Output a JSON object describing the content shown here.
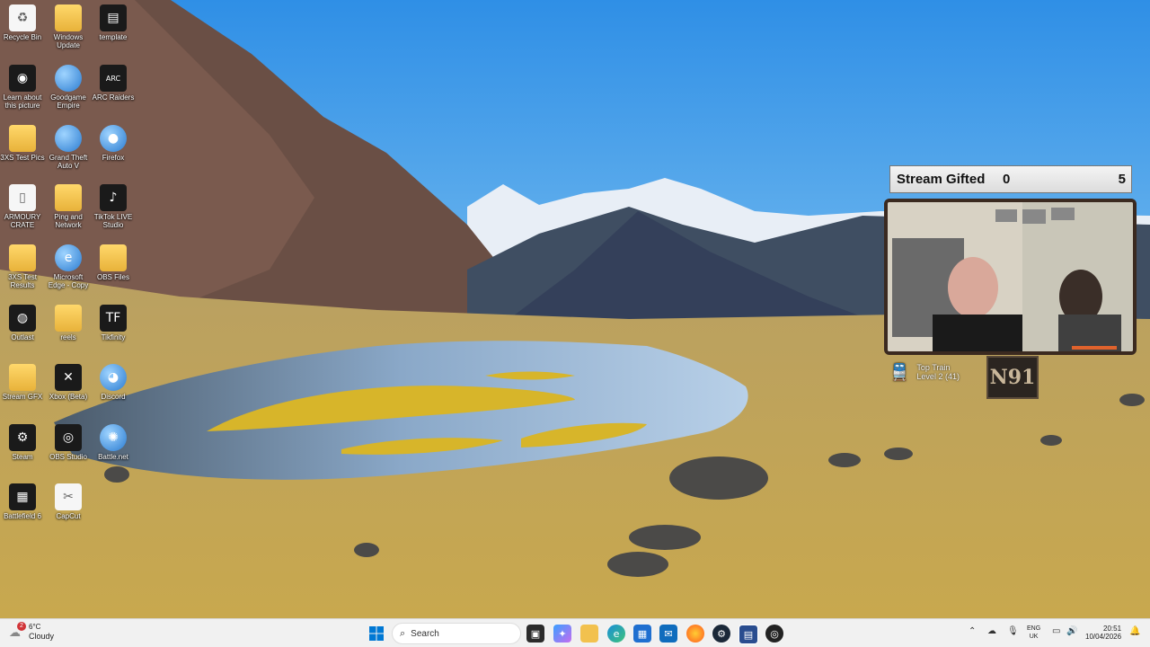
{
  "desktop_icons": [
    {
      "label": "Recycle Bin",
      "icon": "recycle-bin-icon",
      "glyph": "♻"
    },
    {
      "label": "Windows Update",
      "icon": "folder-icon",
      "glyph": ""
    },
    {
      "label": "template",
      "icon": "template-icon",
      "glyph": "▤"
    },
    {
      "label": "Learn about this picture",
      "icon": "camera-icon",
      "glyph": "◉"
    },
    {
      "label": "Goodgame Empire",
      "icon": "globe-icon",
      "glyph": ""
    },
    {
      "label": "ARC Raiders",
      "icon": "arc-raiders-icon",
      "glyph": "ARC"
    },
    {
      "label": "3XS Test Pics",
      "icon": "folder-icon",
      "glyph": ""
    },
    {
      "label": "Grand Theft Auto V",
      "icon": "globe-icon",
      "glyph": ""
    },
    {
      "label": "Firefox",
      "icon": "firefox-icon",
      "glyph": "●"
    },
    {
      "label": "ARMOURY CRATE",
      "icon": "file-icon",
      "glyph": "▯"
    },
    {
      "label": "Ping and Network",
      "icon": "folder-icon",
      "glyph": ""
    },
    {
      "label": "TikTok LIVE Studio",
      "icon": "tiktok-icon",
      "glyph": "♪"
    },
    {
      "label": "3XS Test Results",
      "icon": "folder-icon",
      "glyph": ""
    },
    {
      "label": "Microsoft Edge - Copy",
      "icon": "edge-icon",
      "glyph": "e"
    },
    {
      "label": "OBS Files",
      "icon": "folder-icon",
      "glyph": ""
    },
    {
      "label": "Outlast",
      "icon": "outlast-icon",
      "glyph": "◍"
    },
    {
      "label": "reels",
      "icon": "folder-icon",
      "glyph": ""
    },
    {
      "label": "Tikfinity",
      "icon": "tikfinity-icon",
      "glyph": "TF"
    },
    {
      "label": "Stream GFX",
      "icon": "folder-icon",
      "glyph": ""
    },
    {
      "label": "Xbox (Beta)",
      "icon": "xbox-icon",
      "glyph": "✕"
    },
    {
      "label": "Discord",
      "icon": "discord-icon",
      "glyph": "◕"
    },
    {
      "label": "Steam",
      "icon": "steam-icon",
      "glyph": "⚙"
    },
    {
      "label": "OBS Studio",
      "icon": "obs-icon",
      "glyph": "◎"
    },
    {
      "label": "Battle.net",
      "icon": "battlenet-icon",
      "glyph": "✺"
    },
    {
      "label": "Battlefield 6",
      "icon": "battlefield-icon",
      "glyph": "▦"
    },
    {
      "label": "CapCut",
      "icon": "capcut-icon",
      "glyph": "✂"
    }
  ],
  "overlay": {
    "gifted_label": "Stream Gifted",
    "gifted_value": "0",
    "gifted_goal": "5",
    "train_title": "Top Train",
    "train_level": "Level 2 (41)",
    "logo_text": "N91"
  },
  "taskbar": {
    "weather_temp": "6°C",
    "weather_condition": "Cloudy",
    "weather_badge": "2",
    "search_placeholder": "Search",
    "lang_top": "ENG",
    "lang_bottom": "UK",
    "time": "20:51",
    "date": "10/04/2026"
  },
  "colors": {
    "taskbar_bg": "#f1f1f1",
    "overlay_frame": "#3b2a20",
    "windows_blue": "#0078d4"
  }
}
